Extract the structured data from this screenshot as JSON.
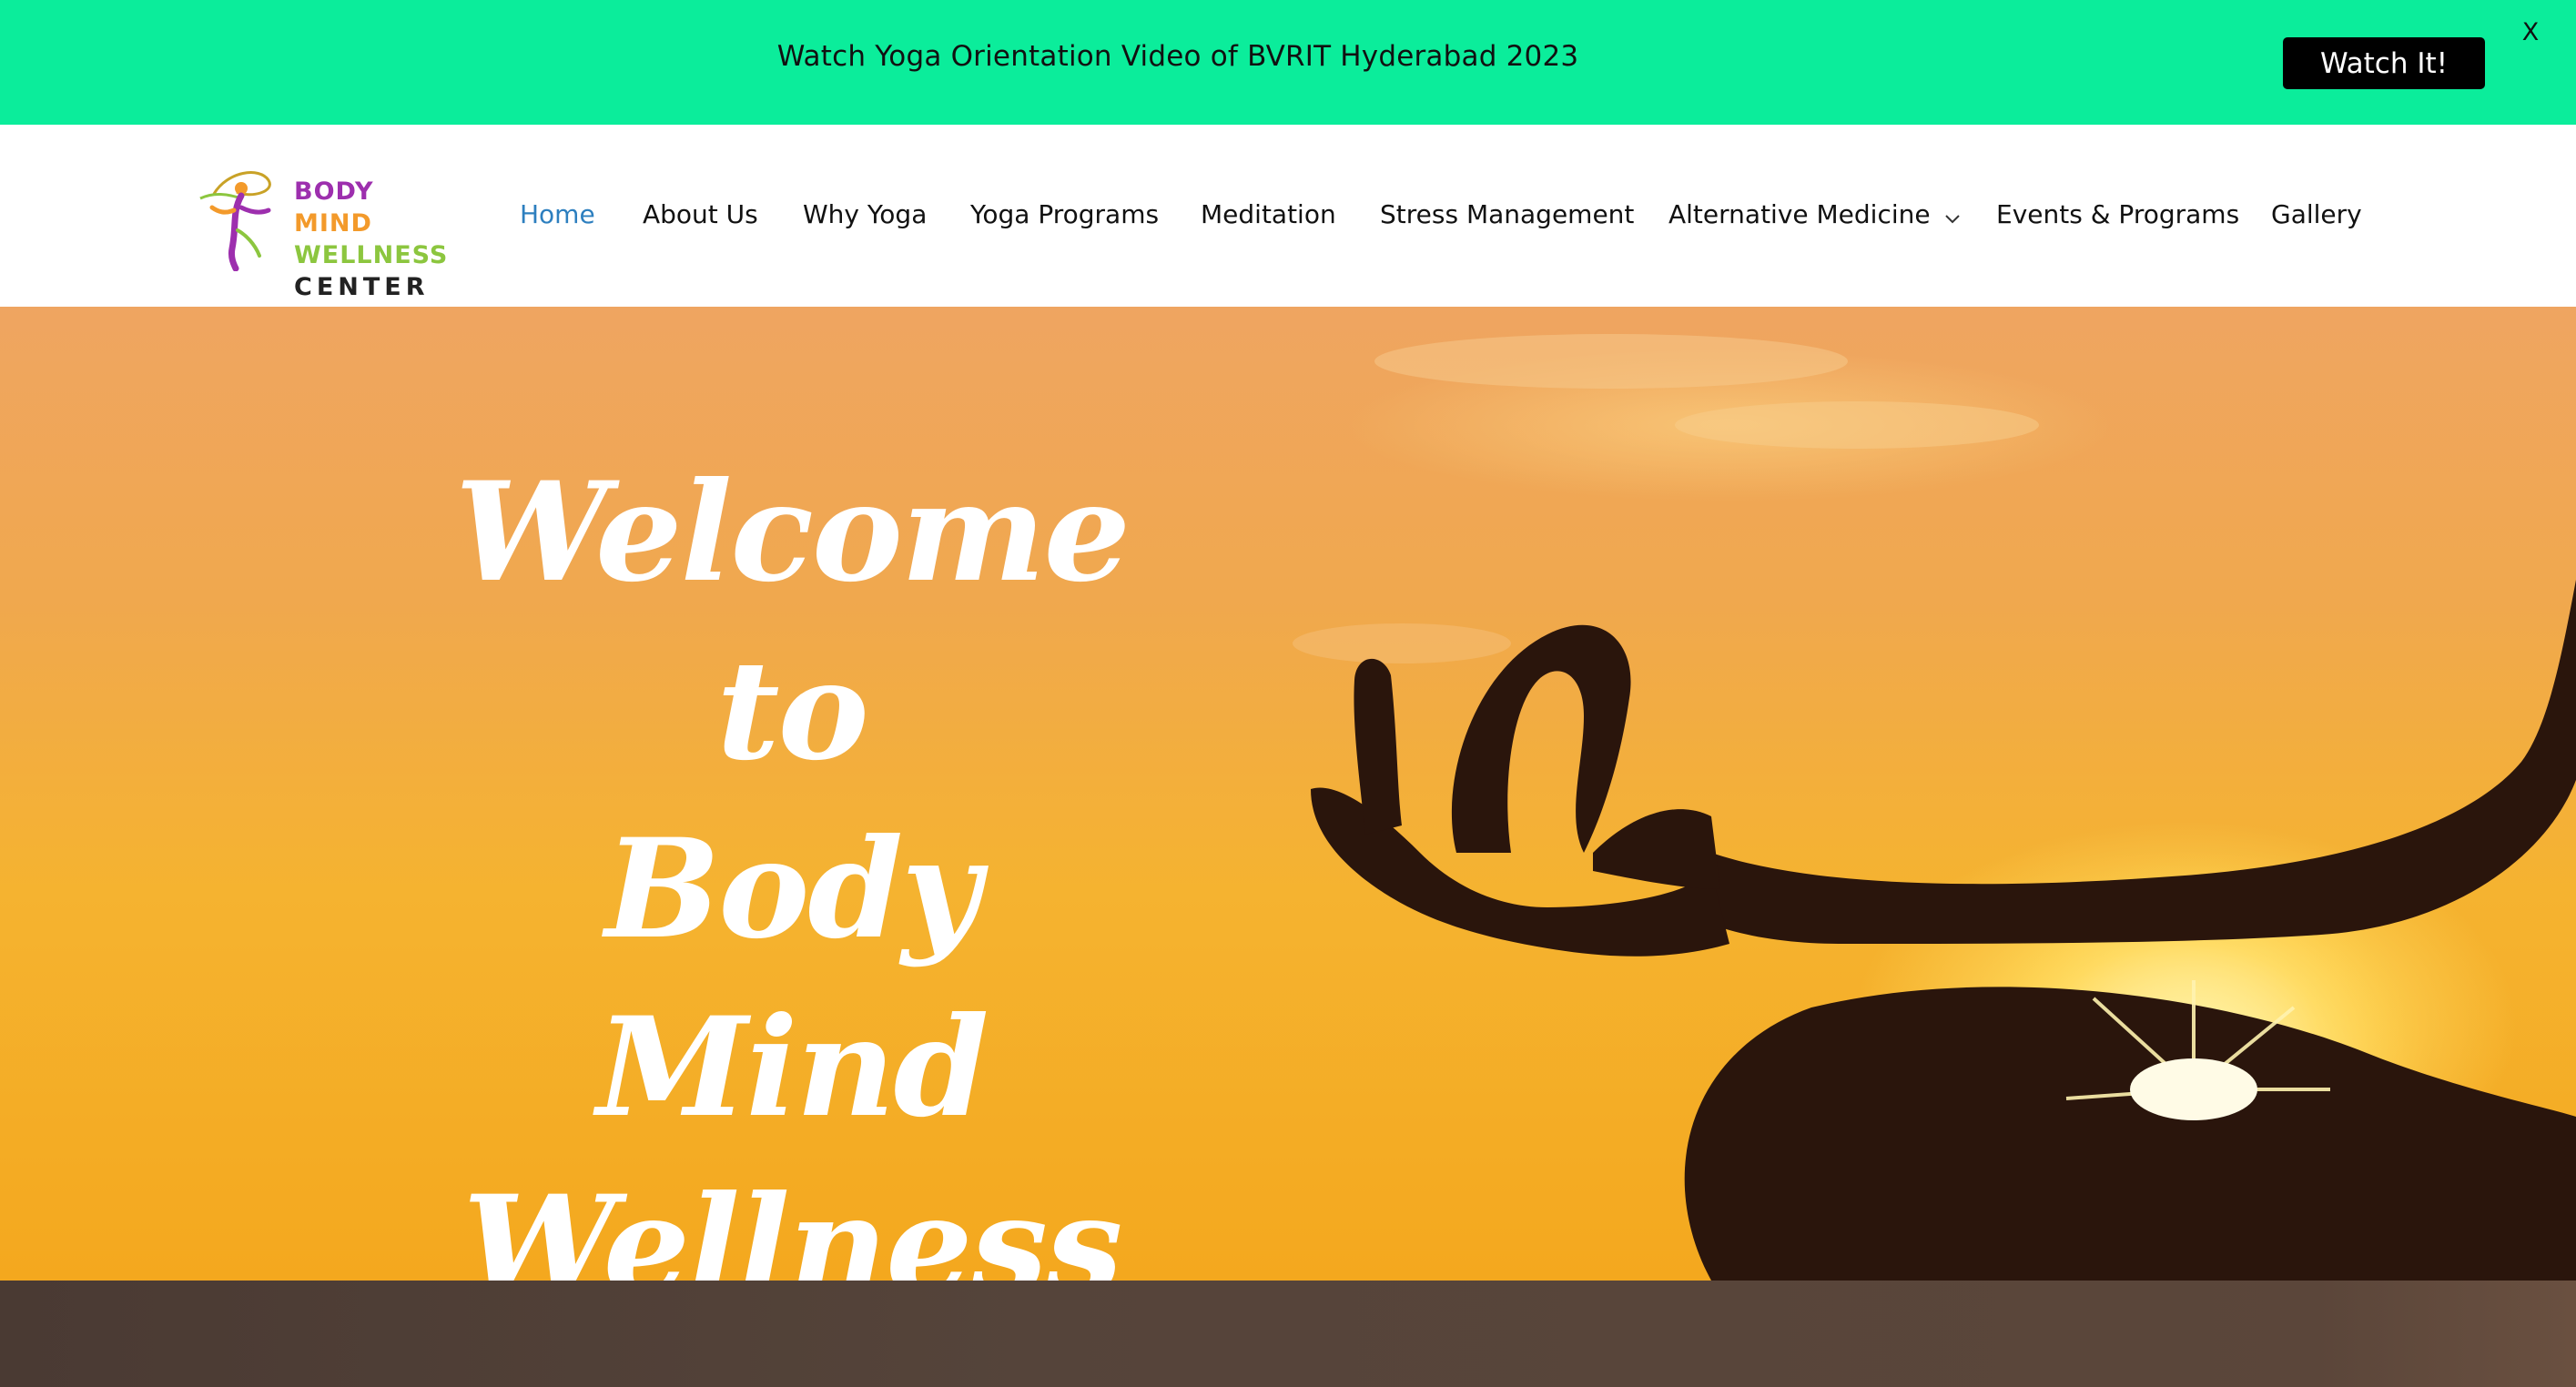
{
  "announcement": {
    "text": "Watch Yoga Orientation Video of BVRIT Hyderabad 2023",
    "button_label": "Watch It!",
    "close_label": "X",
    "background": "#0bed9b"
  },
  "logo": {
    "line1_a": "BODY",
    "line1_b": "MIND",
    "line2": "WELLNESS",
    "line3": "CENTER"
  },
  "nav": {
    "items": [
      {
        "label": "Home",
        "active": true
      },
      {
        "label": "About Us"
      },
      {
        "label": "Why Yoga"
      },
      {
        "label": "Yoga Programs"
      },
      {
        "label": "Meditation"
      },
      {
        "label": "Stress Management"
      },
      {
        "label": "Alternative Medicine",
        "has_dropdown": true
      },
      {
        "label": "Events & Programs"
      },
      {
        "label": "Gallery"
      }
    ],
    "active_color": "#2d7fbf"
  },
  "hero": {
    "line1": "Welcome",
    "line2": "to",
    "line3": "Body Mind",
    "line4": "Wellness"
  }
}
